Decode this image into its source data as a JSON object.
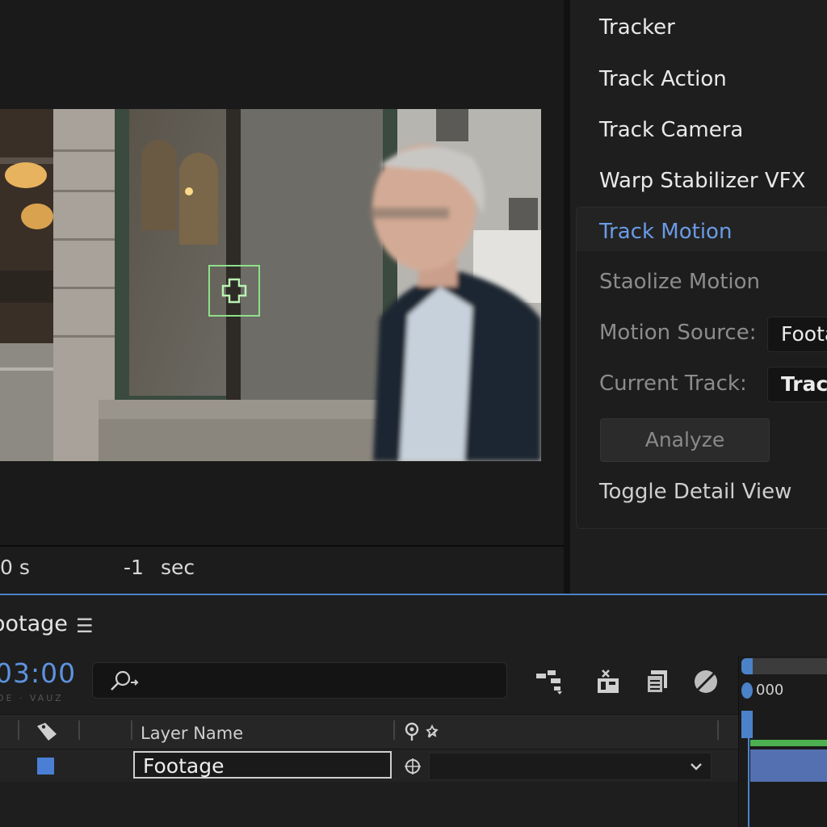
{
  "tracker_panel": {
    "title": "Tracker",
    "buttons": [
      "Track Action",
      "Track Camera",
      "Warp Stabilizer VFX",
      "Track Motion",
      "Staolize Motion"
    ],
    "motion_source_label": "Motion Source:",
    "motion_source_value": "Foota",
    "current_track_label": "Current Track:",
    "current_track_value": "Track",
    "analyze_label": "Analyze",
    "toggle_label": "Toggle Detail View"
  },
  "viewer": {
    "time_left": "0 s",
    "offset_value": "-1",
    "offset_unit": "sec"
  },
  "timeline": {
    "comp_tab": "ootage",
    "menu_icon": "hamburger-icon",
    "timecode": "03:00",
    "fps_faint": "DE · VAUZ",
    "ruler_label": "000",
    "columns": {
      "layer_name": "Layer Name"
    },
    "layer": {
      "name": "Footage",
      "label_color": "#4b7fd6"
    }
  },
  "colors": {
    "accent": "#6a9be6",
    "track_point": "#8fe08a",
    "work_area": "#4caf50",
    "layer_bar": "#5470b0"
  }
}
